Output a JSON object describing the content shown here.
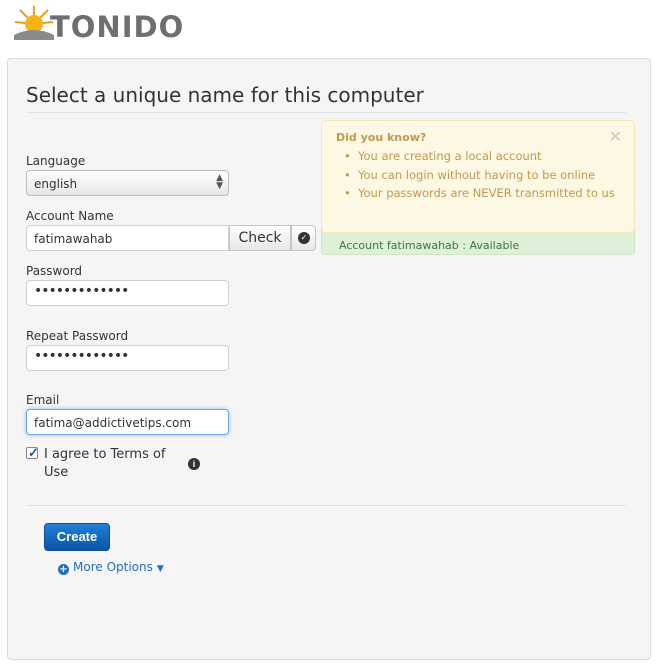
{
  "brand": {
    "logo_text": "TONIDO"
  },
  "page": {
    "title": "Select a unique name for this computer"
  },
  "form": {
    "language": {
      "label": "Language",
      "value": "english"
    },
    "account_name": {
      "label": "Account Name",
      "value": "fatimawahab",
      "check_label": "Check"
    },
    "password": {
      "label": "Password",
      "value": "•••••••••••••"
    },
    "repeat_password": {
      "label": "Repeat Password",
      "value": "•••••••••••••"
    },
    "email": {
      "label": "Email",
      "value": "fatima@addictivetips.com"
    },
    "terms": {
      "label": "I agree to Terms of Use",
      "checked": true
    },
    "create_label": "Create",
    "more_options_label": "More Options"
  },
  "availability": {
    "message": "Account fatimawahab : Available"
  },
  "tip": {
    "title": "Did you know?",
    "items": [
      "You are creating a local account",
      "You can login without having to be online",
      "Your passwords are NEVER transmitted to us"
    ]
  },
  "colors": {
    "accent": "#0c55a8",
    "tip_text": "#c09853",
    "success_bg": "#dff0d8"
  },
  "icons": [
    "sun-logo-icon",
    "select-arrows-icon",
    "ok-circle-icon",
    "checkbox-check-icon",
    "info-icon",
    "plus-icon",
    "caret-down-icon",
    "close-icon"
  ]
}
